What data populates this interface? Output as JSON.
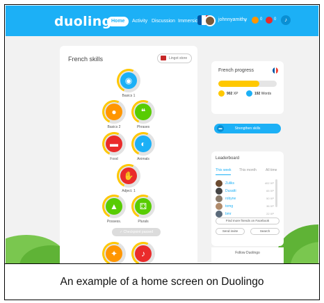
{
  "caption": "An example of a home screen on Duolingo",
  "topbar": {
    "logo": "duolingo",
    "nav": [
      "Home",
      "Activity",
      "Discussion",
      "Immersion"
    ],
    "username": "johnnyamithy",
    "streak": "0",
    "lingots": "0",
    "colors": {
      "bar": "#1cb0f6",
      "streak": "#ff9600",
      "lingots": "#ea2b2b"
    }
  },
  "skills_card": {
    "title": "French skills",
    "lingot_store": "Lingot store",
    "skills": [
      {
        "label": "Basics 1",
        "color": "#1cb0f6",
        "icon": "egg-icon"
      },
      {
        "label": "Basics 2",
        "color": "#ff9600",
        "icon": "chick-icon"
      },
      {
        "label": "Phrases",
        "color": "#58cc02",
        "icon": "speech-icon"
      },
      {
        "label": "Food",
        "color": "#ea2b2b",
        "icon": "burger-icon"
      },
      {
        "label": "Animals",
        "color": "#1cb0f6",
        "icon": "globe-icon"
      },
      {
        "label": "Adject. 1",
        "color": "#ea2b2b",
        "icon": "hand-icon"
      },
      {
        "label": "Possess.",
        "color": "#58cc02",
        "icon": "carrot-icon"
      },
      {
        "label": "Plurals",
        "color": "#58cc02",
        "icon": "dice-icon"
      },
      {
        "label": "",
        "color": "#ff9600",
        "icon": "runner-icon"
      },
      {
        "label": "",
        "color": "#ea2b2b",
        "icon": "sock-icon"
      }
    ],
    "checkpoint": "Checkpoint passed"
  },
  "progress": {
    "title": "French progress",
    "level_fill": 0.7,
    "xp": "902",
    "xp_unit": "XP",
    "words": "192",
    "words_unit": "Words",
    "strengthen": "Strengthen skills"
  },
  "leaderboard": {
    "title": "Leaderboard",
    "tabs": [
      "This week",
      "This month",
      "All time"
    ],
    "rows": [
      {
        "name": "Zuliks",
        "xp": "402 XP",
        "color": "#6b4a2f"
      },
      {
        "name": "Dusatti",
        "xp": "65 XP",
        "color": "#444444"
      },
      {
        "name": "robyne",
        "xp": "50 XP",
        "color": "#8a7a6a"
      },
      {
        "name": "tomg",
        "xp": "36 XP",
        "color": "#b08a6a"
      },
      {
        "name": "bmr",
        "xp": "22 XP",
        "color": "#5a6a7a"
      }
    ],
    "facebook": "Find more friends on Facebook",
    "send_invite": "Send invite",
    "search": "Search"
  },
  "footer": {
    "follow": "Follow Duolingo"
  }
}
